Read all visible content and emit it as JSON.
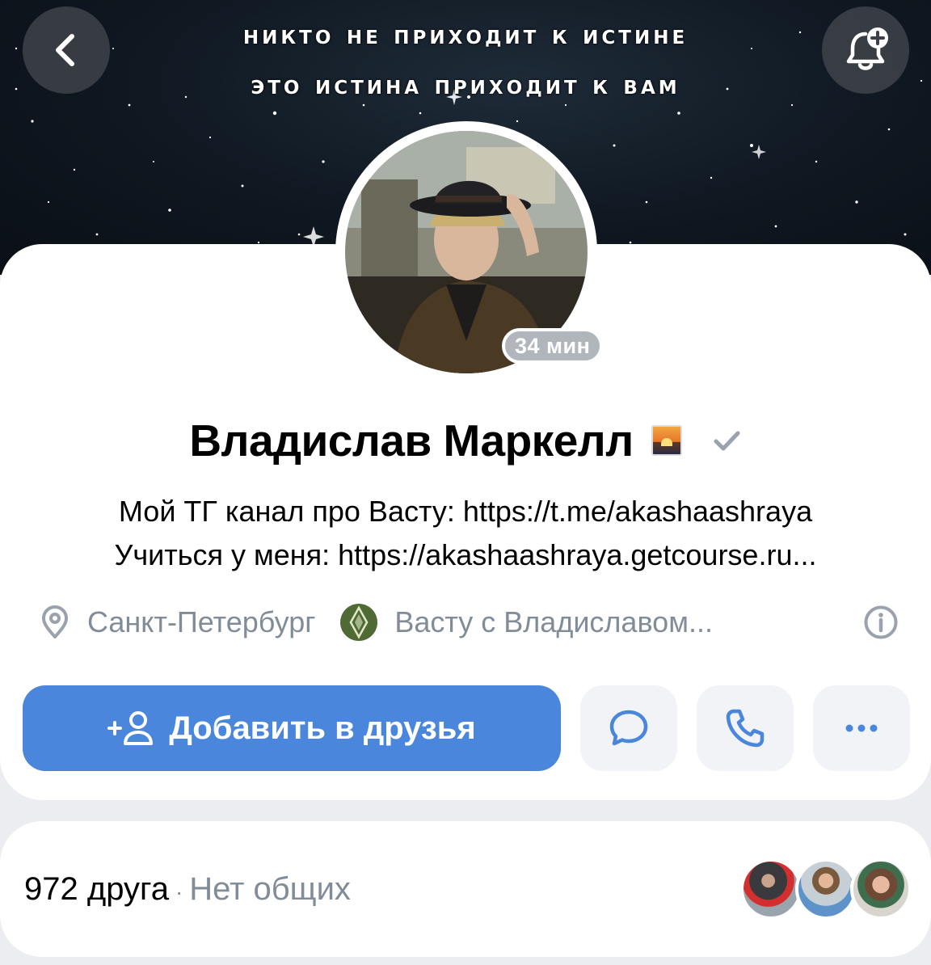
{
  "cover": {
    "quote_line1": "Никто не приходит к истине",
    "quote_line2": "это истина приходит к вам"
  },
  "header": {
    "back_icon": "chevron-left-icon",
    "subscribe_icon": "bell-plus-icon"
  },
  "profile": {
    "name": "Владислав Маркелл",
    "status_emoji": "sunset-emoji",
    "verified_icon": "checkmark-icon",
    "online": "34 мин",
    "bio_line1": "Мой ТГ канал про Васту: https://t.me/akashaashraya",
    "bio_line2": "Учиться у меня: https://akashaashraya.getcourse.ru...",
    "city": "Санкт-Петербург",
    "group": "Васту с Владиславом..."
  },
  "actions": {
    "add_friend_label": "Добавить в друзья",
    "message_icon": "message-bubble-icon",
    "call_icon": "phone-icon",
    "more_icon": "ellipsis-icon"
  },
  "friends": {
    "count_label": "972 друга",
    "separator": "·",
    "mutual_label": "Нет общих"
  },
  "colors": {
    "accent": "#4986dc",
    "secondary_text": "#818c99",
    "online_badge": "#b1b6bd",
    "background": "#ebedf0"
  }
}
